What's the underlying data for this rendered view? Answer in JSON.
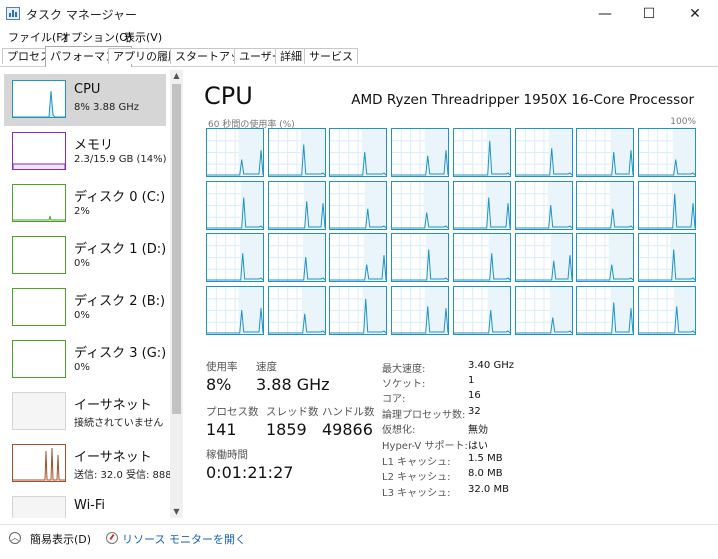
{
  "window": {
    "title": "タスク マネージャー",
    "minimize_glyph": "—",
    "maximize_glyph": "☐",
    "close_glyph": "✕",
    "icon": "task-manager-icon"
  },
  "menu": [
    "ファイル(F)",
    "オプション(O)",
    "表示(V)"
  ],
  "tabs": [
    "プロセス",
    "パフォーマンス",
    "アプリの履歴",
    "スタートアップ",
    "ユーザー",
    "詳細",
    "サービス"
  ],
  "active_tab": 1,
  "sidebar": {
    "items": [
      {
        "name": "CPU",
        "detail": "8%  3.88 GHz",
        "color": "#1f93c7"
      },
      {
        "name": "メモリ",
        "detail": "2.3/15.9 GB (14%)",
        "color": "#8b2bb5"
      },
      {
        "name": "ディスク 0 (C:)",
        "detail": "2%",
        "color": "#4da329"
      },
      {
        "name": "ディスク 1 (D:)",
        "detail": "0%",
        "color": "#4da329"
      },
      {
        "name": "ディスク 2 (B:)",
        "detail": "0%",
        "color": "#4da329"
      },
      {
        "name": "ディスク 3 (G:)",
        "detail": "0%",
        "color": "#4da329"
      },
      {
        "name": "イーサネット",
        "detail": "接続されていません",
        "color": "#bbbbbb"
      },
      {
        "name": "イーサネット",
        "detail": "送信: 32.0  受信: 888",
        "color": "#a0522d"
      },
      {
        "name": "Wi-Fi",
        "detail": "",
        "color": "#bbbbbb"
      }
    ],
    "selected": 0
  },
  "cpu": {
    "title": "CPU",
    "model": "AMD Ryzen Threadripper 1950X 16-Core Processor",
    "graph_label": "60 秒間の使用率 (%)",
    "graph_max": "100%",
    "core_rows": 4,
    "core_cols": 8,
    "graph_color": "#1f93c7",
    "stats": {
      "usage_label": "使用率",
      "usage_value": "8%",
      "speed_label": "速度",
      "speed_value": "3.88 GHz",
      "processes_label": "プロセス数",
      "processes_value": "141",
      "threads_label": "スレッド数",
      "threads_value": "1859",
      "handles_label": "ハンドル数",
      "handles_value": "49866",
      "uptime_label": "稼働時間",
      "uptime_value": "0:01:21:27"
    },
    "specs": [
      {
        "key": "最大速度:",
        "value": "3.40 GHz"
      },
      {
        "key": "ソケット:",
        "value": "1"
      },
      {
        "key": "コア:",
        "value": "16"
      },
      {
        "key": "論理プロセッサ数:",
        "value": "32"
      },
      {
        "key": "仮想化:",
        "value": "無効"
      },
      {
        "key": "Hyper-V サポート:",
        "value": "はい"
      },
      {
        "key": "L1 キャッシュ:",
        "value": "1.5 MB"
      },
      {
        "key": "L2 キャッシュ:",
        "value": "8.0 MB"
      },
      {
        "key": "L3 キャッシュ:",
        "value": "32.0 MB"
      }
    ]
  },
  "footer": {
    "fewer_details": "簡易表示(D)",
    "resource_monitor": "リソース モニターを開く"
  }
}
